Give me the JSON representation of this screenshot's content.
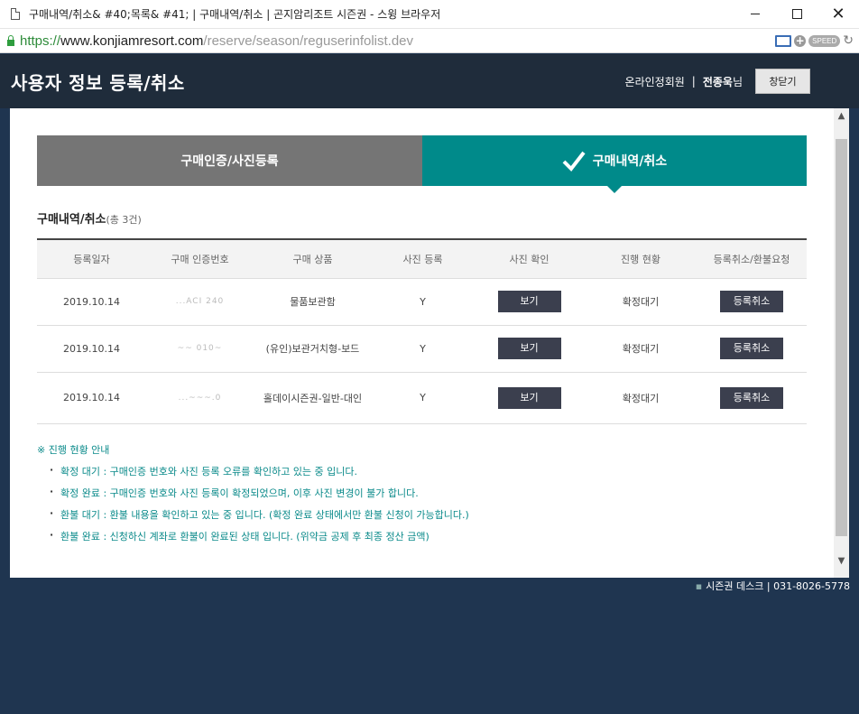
{
  "window": {
    "title": "구매내역/취소& #40;목록& #41; | 구매내역/취소 | 곤지암리조트 시즌권 - 스윙 브라우저",
    "minimize": "",
    "maximize": "",
    "close": "✕"
  },
  "address": {
    "scheme": "https://",
    "host": "www.konjiamresort.com",
    "path": "/reserve/season/reguserinfolist.dev",
    "speed": "SPEED",
    "plus": "+",
    "reload": "↻"
  },
  "header": {
    "title": "사용자 정보 등록/취소",
    "member_type": "온라인정회원",
    "separator": "|",
    "member_name": "전종욱",
    "member_suffix": "님",
    "close_button": "창닫기"
  },
  "tabs": [
    {
      "label": "구매인증/사진등록",
      "active": false
    },
    {
      "label": "구매내역/취소",
      "active": true
    }
  ],
  "section": {
    "title": "구매내역/취소",
    "count": "(총 3건)"
  },
  "table": {
    "columns": [
      "등록일자",
      "구매 인증번호",
      "구매 상품",
      "사진 등록",
      "사진 확인",
      "진행 현황",
      "등록취소/환불요청"
    ],
    "rows": [
      {
        "date": "2019.10.14",
        "auth_no": "...ACI 240",
        "product": "물품보관함",
        "photo_reg": "Y",
        "view": "보기",
        "status": "확정대기",
        "cancel": "등록취소"
      },
      {
        "date": "2019.10.14",
        "auth_no": "~~ 010~",
        "product": "(유인)보관거치형-보드",
        "photo_reg": "Y",
        "view": "보기",
        "status": "확정대기",
        "cancel": "등록취소"
      },
      {
        "date": "2019.10.14",
        "auth_no": "...~~~.0",
        "product": "홀데이시즌권-일반-대인",
        "photo_reg": "Y",
        "view": "보기",
        "status": "확정대기",
        "cancel": "등록취소"
      }
    ]
  },
  "notice": {
    "head": "※ 진행 현황 안내",
    "items": [
      "확정 대기 : 구매인증 번호와 사진 등록 오류를 확인하고 있는 중 입니다.",
      "확정 완료 : 구매인증 번호와 사진 등록이 확정되었으며, 이후 사진 변경이 불가 합니다.",
      "환불 대기 : 환불 내용을 확인하고 있는 중 입니다. (확정 완료 상태에서만 환불 신청이 가능합니다.)",
      "환불 완료 : 신청하신 계좌로 환불이 완료된 상태 입니다. (위약금 공제 후 최종 정산 금액)"
    ]
  },
  "footer": {
    "desk": "시즌권 데스크 | 031-8026-5778"
  },
  "colors": {
    "accent": "#008a8a",
    "header_bg": "#1f2c3b",
    "button_dark": "#3b3f4e"
  }
}
